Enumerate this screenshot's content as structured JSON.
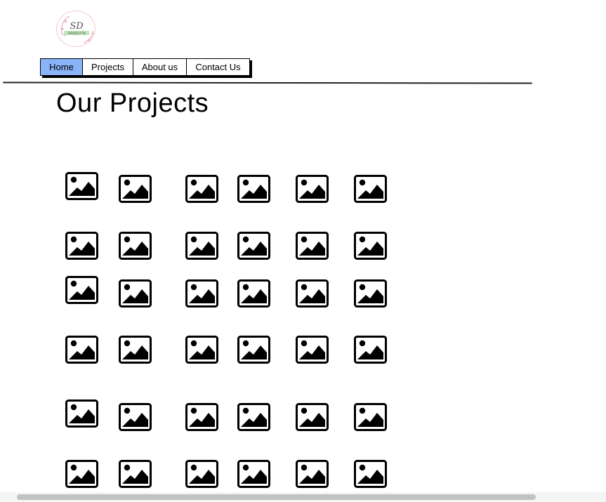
{
  "logo": {
    "initials": "SD",
    "name": "SANDUTA"
  },
  "nav": {
    "items": [
      {
        "label": "Home",
        "active": true
      },
      {
        "label": "Projects",
        "active": false
      },
      {
        "label": "About us",
        "active": false
      },
      {
        "label": "Contact Us",
        "active": false
      }
    ]
  },
  "page": {
    "title": "Our Projects"
  },
  "gallery": {
    "rows": 6,
    "columns": 6,
    "icon": "image-placeholder-icon"
  },
  "colors": {
    "nav_active": "#8ab4f8",
    "logo_accent": "#b9e6b0",
    "logo_floral": "#e8a7b8"
  }
}
